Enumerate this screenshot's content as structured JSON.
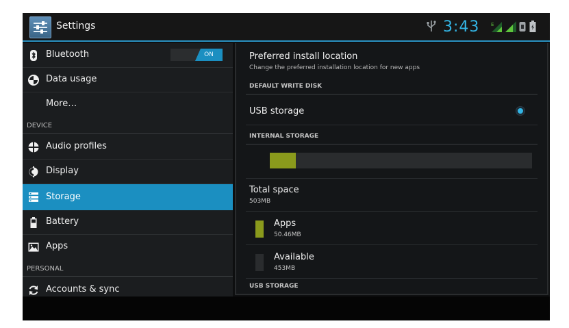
{
  "action_bar": {
    "title": "Settings",
    "icon": "settings-sliders-icon"
  },
  "status_bar": {
    "time": "3:43",
    "icons": [
      "usb-icon",
      "signal-icon",
      "signal-icon",
      "sim-icon",
      "battery-icon"
    ],
    "accent": "#33b5e5"
  },
  "sidebar": {
    "items": [
      {
        "label": "Bluetooth",
        "icon": "bluetooth-icon",
        "toggle": "ON"
      },
      {
        "label": "Data usage",
        "icon": "data-usage-icon"
      },
      {
        "label": "More…"
      }
    ],
    "device_header": "DEVICE",
    "device_items": [
      {
        "label": "Audio profiles",
        "icon": "audio-profiles-icon"
      },
      {
        "label": "Display",
        "icon": "display-icon"
      },
      {
        "label": "Storage",
        "icon": "storage-icon",
        "selected": true
      },
      {
        "label": "Battery",
        "icon": "battery-icon"
      },
      {
        "label": "Apps",
        "icon": "apps-icon"
      }
    ],
    "personal_header": "PERSONAL",
    "personal_items": [
      {
        "label": "Accounts & sync",
        "icon": "sync-icon"
      }
    ]
  },
  "storage": {
    "install_location_title": "Preferred install location",
    "install_location_subtitle": "Change the preferred installation location for new apps",
    "default_write_disk_header": "DEFAULT WRITE DISK",
    "write_disk_option": "USB storage",
    "write_disk_selected": true,
    "internal_storage_header": "INTERNAL STORAGE",
    "usage_fraction": 0.1,
    "total_space_label": "Total space",
    "total_space_value": "503MB",
    "apps_label": "Apps",
    "apps_value": "50.46MB",
    "apps_color": "#8a9a1c",
    "available_label": "Available",
    "available_value": "453MB",
    "available_color": "#2a2c2e",
    "usb_storage_header": "USB STORAGE"
  }
}
